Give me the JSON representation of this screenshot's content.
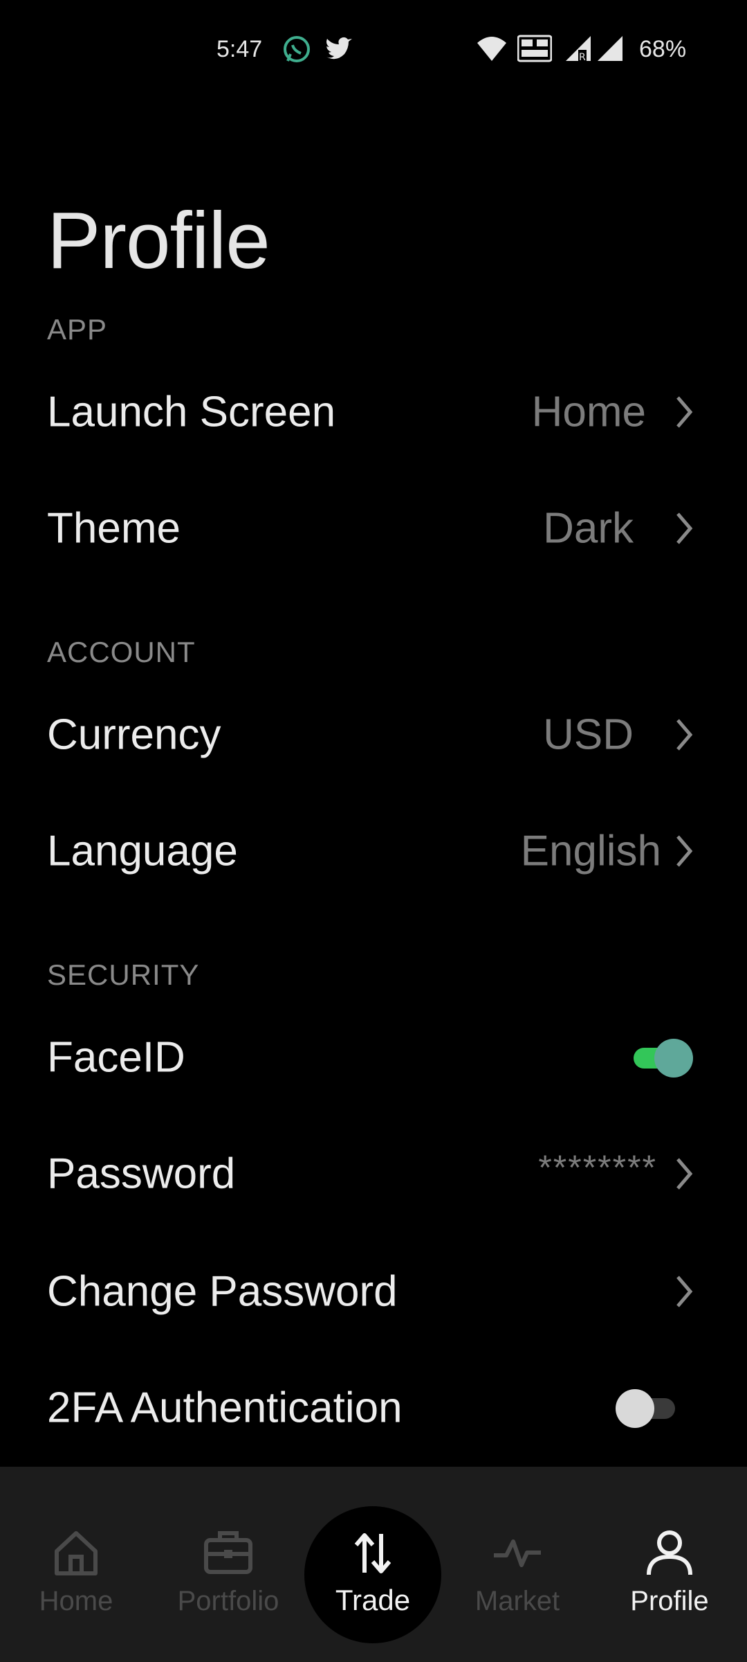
{
  "status_bar": {
    "time": "5:47",
    "battery": "68%",
    "icons": [
      "whatsapp-icon",
      "twitter-icon",
      "wifi-icon",
      "volte-icon",
      "signal-roaming-icon",
      "signal-icon"
    ]
  },
  "page": {
    "title": "Profile"
  },
  "sections": {
    "app": {
      "label": "APP",
      "launch_screen": {
        "label": "Launch Screen",
        "value": "Home"
      },
      "theme": {
        "label": "Theme",
        "value": "Dark"
      }
    },
    "account": {
      "label": "ACCOUNT",
      "currency": {
        "label": "Currency",
        "value": "USD"
      },
      "language": {
        "label": "Language",
        "value": "English"
      }
    },
    "security": {
      "label": "SECURITY",
      "faceid": {
        "label": "FaceID",
        "enabled": true
      },
      "password": {
        "label": "Password",
        "value": "********"
      },
      "change_password": {
        "label": "Change Password"
      },
      "two_fa": {
        "label": "2FA Authentication",
        "enabled": false
      }
    }
  },
  "bottom_nav": {
    "home": "Home",
    "portfolio": "Portfolio",
    "trade": "Trade",
    "market": "Market",
    "profile": "Profile",
    "active": "Profile"
  },
  "colors": {
    "background": "#000000",
    "toggle_on_track": "#33c659",
    "toggle_on_knob": "#5fa89a",
    "toggle_off_track": "#3a3a3a",
    "toggle_off_knob": "#d9d9d9",
    "nav_background": "#1c1c1c"
  }
}
